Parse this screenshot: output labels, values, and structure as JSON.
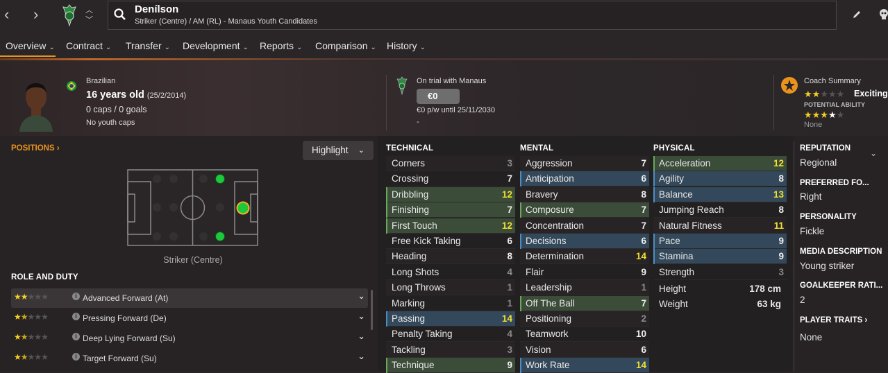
{
  "player": {
    "name": "Denílson",
    "subtitle": "Striker (Centre) / AM (RL) - Manaus Youth Candidates",
    "nationality": "Brazilian",
    "age": "16 years old",
    "dob": "(25/2/2014)",
    "caps": "0 caps / 0 goals",
    "youth_caps": "No youth caps"
  },
  "tabs": [
    {
      "label": "Overview"
    },
    {
      "label": "Contract"
    },
    {
      "label": "Transfer"
    },
    {
      "label": "Development"
    },
    {
      "label": "Reports"
    },
    {
      "label": "Comparison"
    },
    {
      "label": "History"
    }
  ],
  "contract": {
    "status": "On trial with Manaus",
    "value": "€0",
    "wage": "€0 p/w until 25/11/2030",
    "extra": "-"
  },
  "coach": {
    "title": "Coach Summary",
    "current_stars": 2,
    "rating_word": "Exciting",
    "potential_label": "POTENTIAL ABILITY",
    "potential_stars": 4,
    "none_label": "None"
  },
  "positions": {
    "title": "POSITIONS",
    "highlight_label": "Highlight",
    "caption": "Striker (Centre)"
  },
  "roles": {
    "title": "ROLE AND DUTY",
    "items": [
      {
        "name": "Advanced Forward (At)",
        "stars": 2
      },
      {
        "name": "Pressing Forward (De)",
        "stars": 1.5
      },
      {
        "name": "Deep Lying Forward (Su)",
        "stars": 1.5
      },
      {
        "name": "Target Forward (Su)",
        "stars": 1.5
      }
    ]
  },
  "attributes": {
    "technical": {
      "title": "TECHNICAL",
      "items": [
        {
          "name": "Corners",
          "value": "3",
          "hl": ""
        },
        {
          "name": "Crossing",
          "value": "7",
          "hl": ""
        },
        {
          "name": "Dribbling",
          "value": "12",
          "hl": "green"
        },
        {
          "name": "Finishing",
          "value": "7",
          "hl": "green"
        },
        {
          "name": "First Touch",
          "value": "12",
          "hl": "green"
        },
        {
          "name": "Free Kick Taking",
          "value": "6",
          "hl": ""
        },
        {
          "name": "Heading",
          "value": "8",
          "hl": ""
        },
        {
          "name": "Long Shots",
          "value": "4",
          "hl": ""
        },
        {
          "name": "Long Throws",
          "value": "1",
          "hl": ""
        },
        {
          "name": "Marking",
          "value": "1",
          "hl": ""
        },
        {
          "name": "Passing",
          "value": "14",
          "hl": "blue"
        },
        {
          "name": "Penalty Taking",
          "value": "4",
          "hl": ""
        },
        {
          "name": "Tackling",
          "value": "3",
          "hl": ""
        },
        {
          "name": "Technique",
          "value": "9",
          "hl": "green"
        }
      ]
    },
    "mental": {
      "title": "MENTAL",
      "items": [
        {
          "name": "Aggression",
          "value": "7",
          "hl": ""
        },
        {
          "name": "Anticipation",
          "value": "6",
          "hl": "blue"
        },
        {
          "name": "Bravery",
          "value": "8",
          "hl": ""
        },
        {
          "name": "Composure",
          "value": "7",
          "hl": "green"
        },
        {
          "name": "Concentration",
          "value": "7",
          "hl": ""
        },
        {
          "name": "Decisions",
          "value": "6",
          "hl": "blue"
        },
        {
          "name": "Determination",
          "value": "14",
          "hl": ""
        },
        {
          "name": "Flair",
          "value": "9",
          "hl": ""
        },
        {
          "name": "Leadership",
          "value": "1",
          "hl": ""
        },
        {
          "name": "Off The Ball",
          "value": "7",
          "hl": "green"
        },
        {
          "name": "Positioning",
          "value": "2",
          "hl": ""
        },
        {
          "name": "Teamwork",
          "value": "10",
          "hl": ""
        },
        {
          "name": "Vision",
          "value": "6",
          "hl": ""
        },
        {
          "name": "Work Rate",
          "value": "14",
          "hl": "blue"
        }
      ]
    },
    "physical": {
      "title": "PHYSICAL",
      "items": [
        {
          "name": "Acceleration",
          "value": "12",
          "hl": "green"
        },
        {
          "name": "Agility",
          "value": "8",
          "hl": "blue"
        },
        {
          "name": "Balance",
          "value": "13",
          "hl": "blue"
        },
        {
          "name": "Jumping Reach",
          "value": "8",
          "hl": ""
        },
        {
          "name": "Natural Fitness",
          "value": "11",
          "hl": ""
        },
        {
          "name": "Pace",
          "value": "9",
          "hl": "blue"
        },
        {
          "name": "Stamina",
          "value": "9",
          "hl": "blue"
        },
        {
          "name": "Strength",
          "value": "3",
          "hl": ""
        }
      ],
      "height_label": "Height",
      "height_value": "178 cm",
      "weight_label": "Weight",
      "weight_value": "63 kg"
    }
  },
  "side": {
    "reputation_h": "REPUTATION",
    "reputation_v": "Regional",
    "foot_h": "PREFERRED FO...",
    "foot_v": "Right",
    "personality_h": "PERSONALITY",
    "personality_v": "Fickle",
    "media_h": "MEDIA DESCRIPTION",
    "media_v": "Young striker",
    "gk_h": "GOALKEEPER RATI...",
    "gk_v": "2",
    "traits_h": "PLAYER TRAITS",
    "traits_v": "None"
  },
  "colors": {
    "accent_orange": "#e8931e",
    "green_highlight": "#3d4f3a",
    "blue_highlight": "#34495a",
    "yellow_value": "#f0e030",
    "position_green": "#1ec83c"
  }
}
